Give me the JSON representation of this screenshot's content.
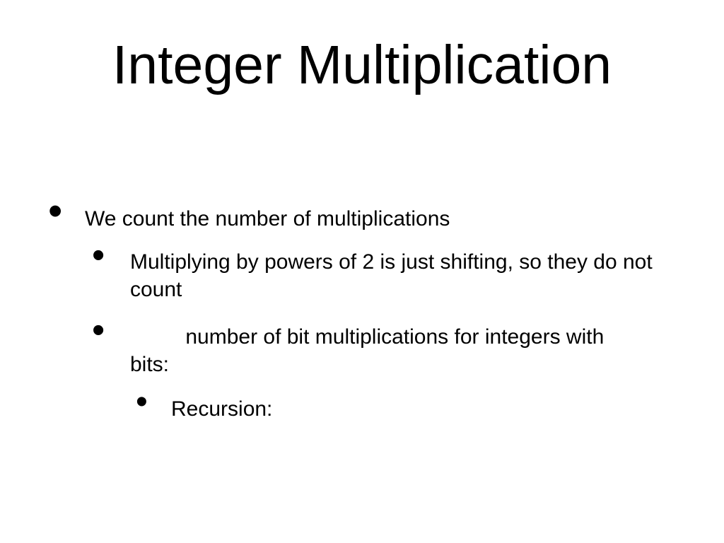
{
  "slide": {
    "title": "Integer Multiplication",
    "bullets": {
      "lvl1": {
        "item1": "We count the number of multiplications"
      },
      "lvl2": {
        "item1": "Multiplying by powers of 2 is just shifting, so they do not count",
        "item2_part1": " ",
        "item2_part2": "number of bit multiplications for integers with",
        "item2_part3": "bits:"
      },
      "lvl3": {
        "item1": "Recursion:"
      }
    }
  }
}
